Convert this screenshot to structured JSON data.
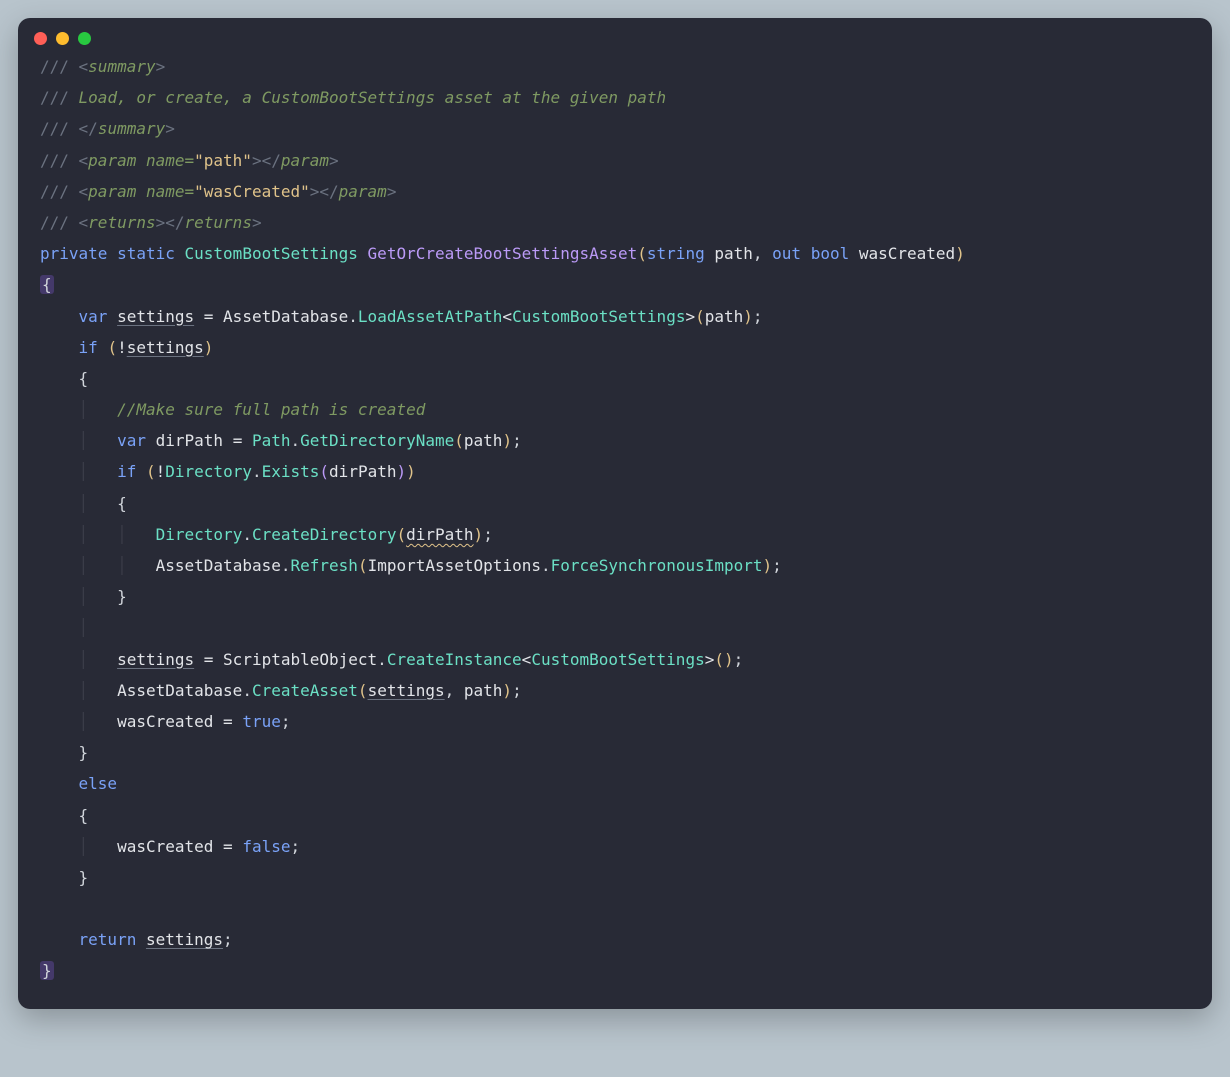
{
  "code": {
    "doc": {
      "slashes": "///",
      "summary_open_lt": " <",
      "summary_open_name": "summary",
      "summary_open_gt": ">",
      "desc": " Load, or create, a CustomBootSettings asset at the given path",
      "summary_close_lt": " </",
      "summary_close_name": "summary",
      "summary_close_gt": ">",
      "param_open_lt": " <",
      "param_word": "param",
      "param_name_attr": " name=",
      "param1_value": "\"path\"",
      "param2_value": "\"wasCreated\"",
      "tag_close_gt": ">",
      "tag_end_lt": "</",
      "returns_word": "returns",
      "returns_close": " <",
      "returns_end": "></"
    },
    "sig": {
      "kw_private": "private",
      "kw_static": "static",
      "retType": "CustomBootSettings",
      "funcName": "GetOrCreateBootSettingsAsset",
      "paramType1": "string",
      "paramName1": "path",
      "kw_out": "out",
      "paramType2": "bool",
      "paramName2": "wasCreated"
    },
    "body": {
      "kw_var": "var",
      "settings": "settings",
      "eq": " = ",
      "AssetDatabase": "AssetDatabase",
      "dot": ".",
      "LoadAssetAtPath": "LoadAssetAtPath",
      "lt": "<",
      "CustomBootSettings": "CustomBootSettings",
      "gt": ">",
      "path": "path",
      "kw_if": "if",
      "not": "!",
      "comment_path": "//Make sure full path is created",
      "dirPath": "dirPath",
      "Path": "Path",
      "GetDirectoryName": "GetDirectoryName",
      "Directory": "Directory",
      "Exists": "Exists",
      "CreateDirectory": "CreateDirectory",
      "Refresh": "Refresh",
      "ImportAssetOptions": "ImportAssetOptions",
      "ForceSynchronousImport": "ForceSynchronousImport",
      "ScriptableObject": "ScriptableObject",
      "CreateInstance": "CreateInstance",
      "CreateAsset": "CreateAsset",
      "wasCreated": "wasCreated",
      "kw_true": "true",
      "kw_false": "false",
      "kw_else": "else",
      "kw_return": "return"
    }
  }
}
